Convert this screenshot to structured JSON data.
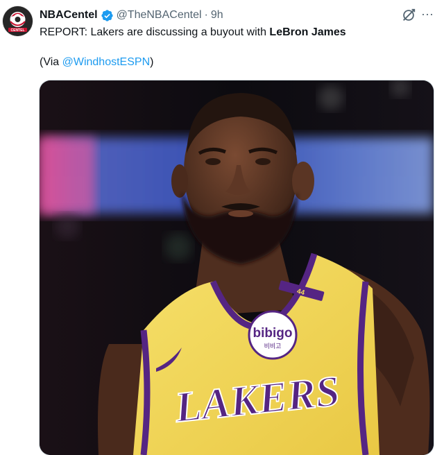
{
  "tweet": {
    "author_name": "NBACentel",
    "author_handle": "@TheNBACentel",
    "separator": "·",
    "time": "9h",
    "more_label": "···",
    "text_before": "REPORT: Lakers are discussing a buyout with ",
    "text_bold": "LeBron James",
    "via_open": "(Via ",
    "via_link": "@WindhostESPN",
    "via_close": ")",
    "avatar_text": "CENTEL"
  },
  "media": {
    "jersey_brand": "LAKERS",
    "patch_text": "bibigo",
    "patch_subtext": "비비고",
    "strap_number": "44"
  },
  "colors": {
    "link": "#1d9bf0",
    "secondary_text": "#536471",
    "verified": "#1d9bf0",
    "jersey_gold": "#f3d95a",
    "jersey_purple": "#552583"
  },
  "icons": [
    "verified-badge-icon",
    "grok-icon",
    "more-icon"
  ]
}
